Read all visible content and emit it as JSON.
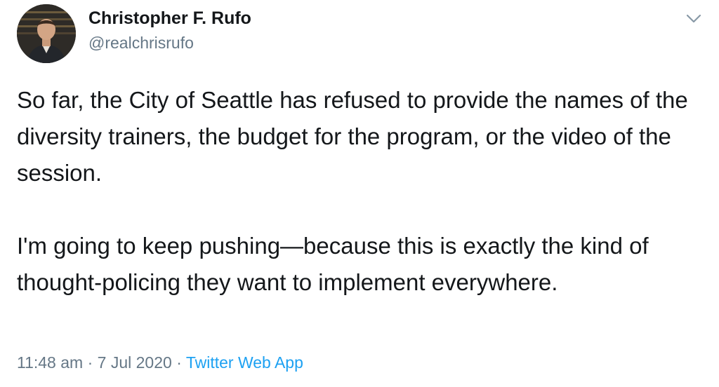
{
  "author": {
    "display_name": "Christopher F. Rufo",
    "handle": "@realchrisrufo",
    "avatar_icon": "profile-photo"
  },
  "menu": {
    "icon": "chevron-down-icon"
  },
  "tweet": {
    "paragraphs": [
      "So far, the City of Seattle has refused to provide the names of the diversity trainers, the budget for the program, or the video of the session.",
      "I'm going to keep pushing—because this is exactly the kind of thought-policing they want to implement everywhere."
    ]
  },
  "meta": {
    "time": "11:48 am",
    "separator": "·",
    "date": "7 Jul 2020",
    "source": "Twitter Web App"
  },
  "colors": {
    "text": "#14171a",
    "secondary": "#657786",
    "link": "#1da1f2"
  }
}
